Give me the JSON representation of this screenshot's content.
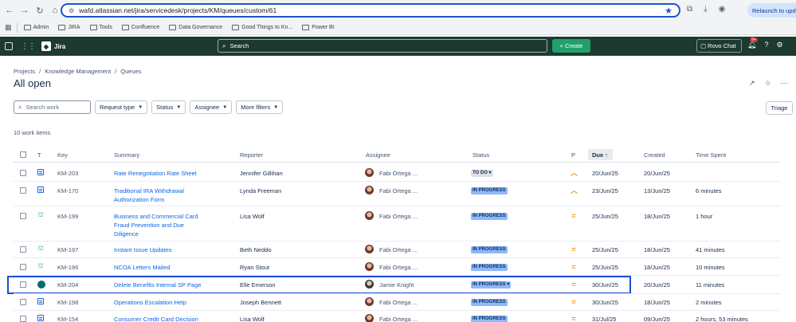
{
  "browser": {
    "url": "wafd.atlassian.net/jira/servicedesk/projects/KM/queues/custom/61",
    "relaunch_label": "Relaunch to update",
    "bookmarks": [
      "Admin",
      "JIRA",
      "Tools",
      "Confluence",
      "Data Governance",
      "Good Things to Kn...",
      "Power BI"
    ]
  },
  "jira": {
    "app_name": "Jira",
    "search_placeholder": "Search",
    "create_label": "Create",
    "rovo_label": "Rovo Chat",
    "notification_count": "9+"
  },
  "page": {
    "breadcrumb": [
      "Projects",
      "Knowledge Management",
      "Queues"
    ],
    "title": "All open",
    "search_placeholder": "Search work",
    "filters": [
      "Request type",
      "Status",
      "Assignee",
      "More filters"
    ],
    "triage_label": "Triage",
    "item_count": "10 work items"
  },
  "table": {
    "headers": {
      "t": "T",
      "key": "Key",
      "summary": "Summary",
      "reporter": "Reporter",
      "assignee": "Assignee",
      "status": "Status",
      "p": "P",
      "due": "Due",
      "created": "Created",
      "time_spent": "Time Spent"
    },
    "rows": [
      {
        "key": "KM-203",
        "summary": "Rate Renegotiation Rate Sheet",
        "reporter": "Jennifer Gillihan",
        "assignee": "Fabi Ortega ...",
        "status": "TO DO",
        "priority": "high",
        "due": "20/Jun/25",
        "created": "20/Jun/25",
        "time_spent": ""
      },
      {
        "key": "KM-170",
        "summary": "Traditional IRA Withdrawal Authorization Form",
        "reporter": "Lynda Freeman",
        "assignee": "Fabi Ortega ...",
        "status": "IN PROGRESS",
        "priority": "high",
        "due": "23/Jun/25",
        "created": "13/Jun/25",
        "time_spent": "6 minutes"
      },
      {
        "key": "KM-199",
        "summary": "Business and Commercial Card Fraud Prevention and Due Diligence",
        "reporter": "Lisa Wolf",
        "assignee": "Fabi Ortega ...",
        "status": "IN PROGRESS",
        "priority": "medium",
        "due": "25/Jun/25",
        "created": "18/Jun/25",
        "time_spent": "1 hour"
      },
      {
        "key": "KM-197",
        "summary": "Instant Issue Updates",
        "reporter": "Beth Neddo",
        "assignee": "Fabi Ortega ...",
        "status": "IN PROGRESS",
        "priority": "medium",
        "due": "25/Jun/25",
        "created": "18/Jun/25",
        "time_spent": "41 minutes"
      },
      {
        "key": "KM-196",
        "summary": "NCOA Letters Mailed",
        "reporter": "Ryan Stout",
        "assignee": "Fabi Ortega ...",
        "status": "IN PROGRESS",
        "priority": "medium",
        "due": "25/Jun/25",
        "created": "18/Jun/25",
        "time_spent": "10 minutes"
      },
      {
        "key": "KM-204",
        "summary": "Delete Benefits Internal SP Page",
        "reporter": "Elle Emerson",
        "assignee": "Jamie Knight",
        "status": "IN PROGRESS",
        "priority": "medium",
        "due": "30/Jun/25",
        "created": "20/Jun/25",
        "time_spent": "11 minutes"
      },
      {
        "key": "KM-198",
        "summary": "Operations Escalation Help",
        "reporter": "Joseph Bennett",
        "assignee": "Fabi Ortega ...",
        "status": "IN PROGRESS",
        "priority": "medium",
        "due": "30/Jun/25",
        "created": "18/Jun/25",
        "time_spent": "2 minutes"
      },
      {
        "key": "KM-154",
        "summary": "Consumer Credit Card Decision",
        "reporter": "Lisa Wolf",
        "assignee": "Fabi Ortega ...",
        "status": "IN PROGRESS",
        "priority": "medium",
        "due": "31/Jul/25",
        "created": "09/Jun/25",
        "time_spent": "2 hours, 53 minutes"
      }
    ]
  }
}
